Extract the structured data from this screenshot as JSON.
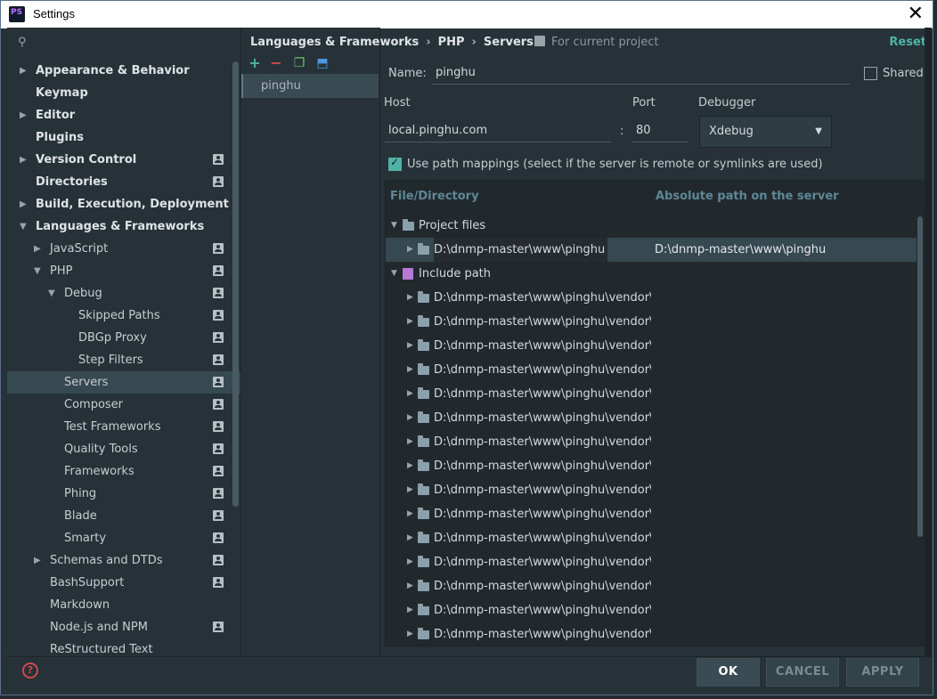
{
  "window": {
    "title": "Settings"
  },
  "breadcrumb": [
    "Languages & Frameworks",
    "PHP",
    "Servers"
  ],
  "current_project": "For current project",
  "reset_label": "Reset",
  "sidebar": {
    "items": [
      {
        "label": "Appearance & Behavior",
        "level": 0,
        "arrow": "right",
        "bold": true,
        "proj": false
      },
      {
        "label": "Keymap",
        "level": 0,
        "arrow": "",
        "bold": true,
        "proj": false
      },
      {
        "label": "Editor",
        "level": 0,
        "arrow": "right",
        "bold": true,
        "proj": false
      },
      {
        "label": "Plugins",
        "level": 0,
        "arrow": "",
        "bold": true,
        "proj": false
      },
      {
        "label": "Version Control",
        "level": 0,
        "arrow": "right",
        "bold": true,
        "proj": true
      },
      {
        "label": "Directories",
        "level": 0,
        "arrow": "",
        "bold": true,
        "proj": true
      },
      {
        "label": "Build, Execution, Deployment",
        "level": 0,
        "arrow": "right",
        "bold": true,
        "proj": false
      },
      {
        "label": "Languages & Frameworks",
        "level": 0,
        "arrow": "down",
        "bold": true,
        "proj": false
      },
      {
        "label": "JavaScript",
        "level": 1,
        "arrow": "right",
        "bold": false,
        "proj": true
      },
      {
        "label": "PHP",
        "level": 1,
        "arrow": "down",
        "bold": false,
        "proj": true
      },
      {
        "label": "Debug",
        "level": 2,
        "arrow": "down",
        "bold": false,
        "proj": true
      },
      {
        "label": "Skipped Paths",
        "level": 3,
        "arrow": "",
        "bold": false,
        "proj": true
      },
      {
        "label": "DBGp Proxy",
        "level": 3,
        "arrow": "",
        "bold": false,
        "proj": true
      },
      {
        "label": "Step Filters",
        "level": 3,
        "arrow": "",
        "bold": false,
        "proj": true
      },
      {
        "label": "Servers",
        "level": 2,
        "arrow": "",
        "bold": false,
        "proj": true,
        "selected": true
      },
      {
        "label": "Composer",
        "level": 2,
        "arrow": "",
        "bold": false,
        "proj": true
      },
      {
        "label": "Test Frameworks",
        "level": 2,
        "arrow": "",
        "bold": false,
        "proj": true
      },
      {
        "label": "Quality Tools",
        "level": 2,
        "arrow": "",
        "bold": false,
        "proj": true
      },
      {
        "label": "Frameworks",
        "level": 2,
        "arrow": "",
        "bold": false,
        "proj": true
      },
      {
        "label": "Phing",
        "level": 2,
        "arrow": "",
        "bold": false,
        "proj": true
      },
      {
        "label": "Blade",
        "level": 2,
        "arrow": "",
        "bold": false,
        "proj": true
      },
      {
        "label": "Smarty",
        "level": 2,
        "arrow": "",
        "bold": false,
        "proj": true
      },
      {
        "label": "Schemas and DTDs",
        "level": 1,
        "arrow": "right",
        "bold": false,
        "proj": true
      },
      {
        "label": "BashSupport",
        "level": 1,
        "arrow": "",
        "bold": false,
        "proj": true
      },
      {
        "label": "Markdown",
        "level": 1,
        "arrow": "",
        "bold": false,
        "proj": false
      },
      {
        "label": "Node.js and NPM",
        "level": 1,
        "arrow": "",
        "bold": false,
        "proj": true
      },
      {
        "label": "ReStructured Text",
        "level": 1,
        "arrow": "",
        "bold": false,
        "proj": false
      }
    ]
  },
  "servers": [
    "pinghu"
  ],
  "form": {
    "name_label": "Name:",
    "name_value": "pinghu",
    "shared_label": "Shared",
    "host_label": "Host",
    "host_value": "local.pinghu.com",
    "colon": ":",
    "port_label": "Port",
    "port_value": "80",
    "debugger_label": "Debugger",
    "debugger_value": "Xdebug",
    "path_mapping_label": "Use path mappings (select if the server is remote or symlinks are used)"
  },
  "mapping_table": {
    "col_file": "File/Directory",
    "col_server": "Absolute path on the server",
    "project_files_label": "Project files",
    "project_row": {
      "path": "D:\\dnmp-master\\www\\pinghu",
      "server_path": "D:\\dnmp-master\\www\\pinghu"
    },
    "include_path_label": "Include path",
    "include_rows": [
      "D:\\dnmp-master\\www\\pinghu\\vendor\\alib",
      "D:\\dnmp-master\\www\\pinghu\\vendor\\con",
      "D:\\dnmp-master\\www\\pinghu\\vendor\\myc",
      "D:\\dnmp-master\\www\\pinghu\\vendor\\seta",
      "D:\\dnmp-master\\www\\pinghu\\vendor\\ralc",
      "D:\\dnmp-master\\www\\pinghu\\vendor\\guz",
      "D:\\dnmp-master\\www\\pinghu\\vendor\\psr'",
      "D:\\dnmp-master\\www\\pinghu\\vendor\\alib",
      "D:\\dnmp-master\\www\\pinghu\\vendor\\mtc",
      "D:\\dnmp-master\\www\\pinghu\\vendor\\psr'",
      "D:\\dnmp-master\\www\\pinghu\\vendor\\mo",
      "D:\\dnmp-master\\www\\pinghu\\vendor\\mp",
      "D:\\dnmp-master\\www\\pinghu\\vendor\\adt",
      "D:\\dnmp-master\\www\\pinghu\\vendor\\sym",
      "D:\\dnmp-master\\www\\pinghu\\vendor\\sym"
    ]
  },
  "buttons": {
    "ok": "OK",
    "cancel": "CANCEL",
    "apply": "APPLY"
  },
  "colors": {
    "accent": "#4fb3a6",
    "background": "#263238",
    "selection": "#364850"
  }
}
